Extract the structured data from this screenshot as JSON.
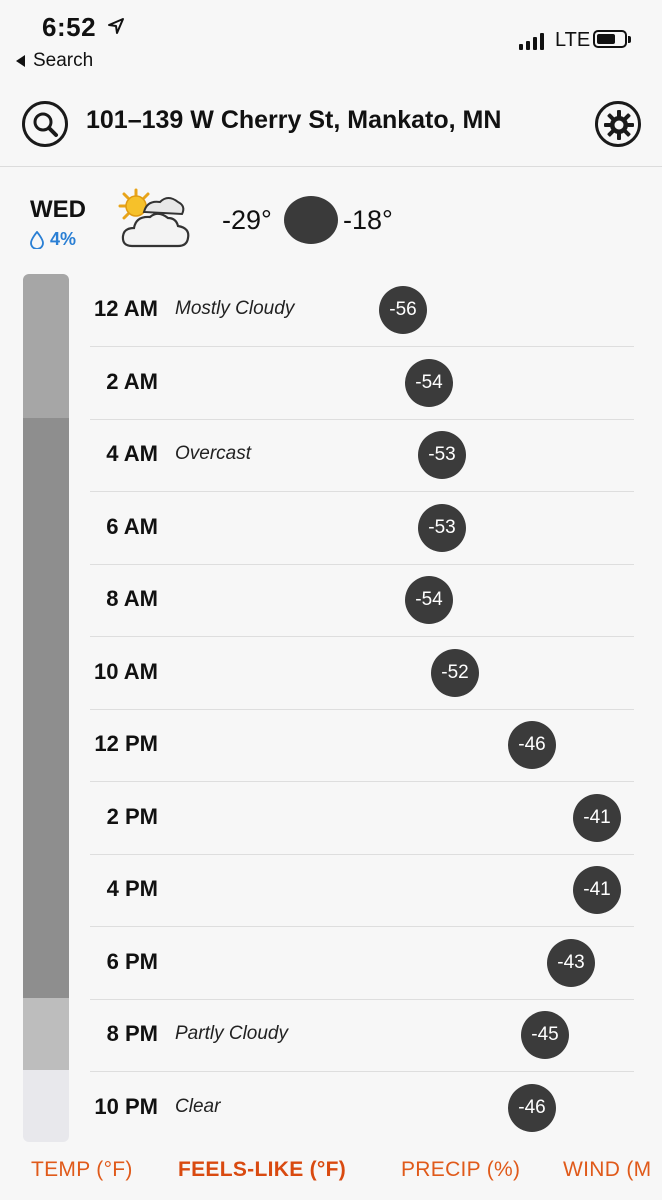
{
  "status_bar": {
    "time": "6:52",
    "back_label": "Search",
    "network": "LTE"
  },
  "header": {
    "address": "101–139 W Cherry St, Mankato, MN",
    "search_icon": "search-icon",
    "settings_icon": "gear-icon"
  },
  "day_summary": {
    "day": "WED",
    "precip_chance": "4%",
    "icon": "partly-cloudy-icon",
    "low": "-29°",
    "high": "-18°"
  },
  "hourly": [
    {
      "time": "12 AM",
      "condition": "Mostly Cloudy",
      "value": "-56"
    },
    {
      "time": "2 AM",
      "condition": "",
      "value": "-54"
    },
    {
      "time": "4 AM",
      "condition": "Overcast",
      "value": "-53"
    },
    {
      "time": "6 AM",
      "condition": "",
      "value": "-53"
    },
    {
      "time": "8 AM",
      "condition": "",
      "value": "-54"
    },
    {
      "time": "10 AM",
      "condition": "",
      "value": "-52"
    },
    {
      "time": "12 PM",
      "condition": "",
      "value": "-46"
    },
    {
      "time": "2 PM",
      "condition": "",
      "value": "-41"
    },
    {
      "time": "4 PM",
      "condition": "",
      "value": "-41"
    },
    {
      "time": "6 PM",
      "condition": "",
      "value": "-43"
    },
    {
      "time": "8 PM",
      "condition": "Partly Cloudy",
      "value": "-45"
    },
    {
      "time": "10 PM",
      "condition": "Clear",
      "value": "-46"
    }
  ],
  "tabs": [
    {
      "label": "TEMP (°F)",
      "active": false
    },
    {
      "label": "FEELS-LIKE (°F)",
      "active": true
    },
    {
      "label": "PRECIP (%)",
      "active": false
    },
    {
      "label": "WIND (M",
      "active": false
    }
  ],
  "colors": {
    "accent": "#e05a1a",
    "bubble": "#3b3b3b",
    "precip": "#2a7fd4"
  }
}
